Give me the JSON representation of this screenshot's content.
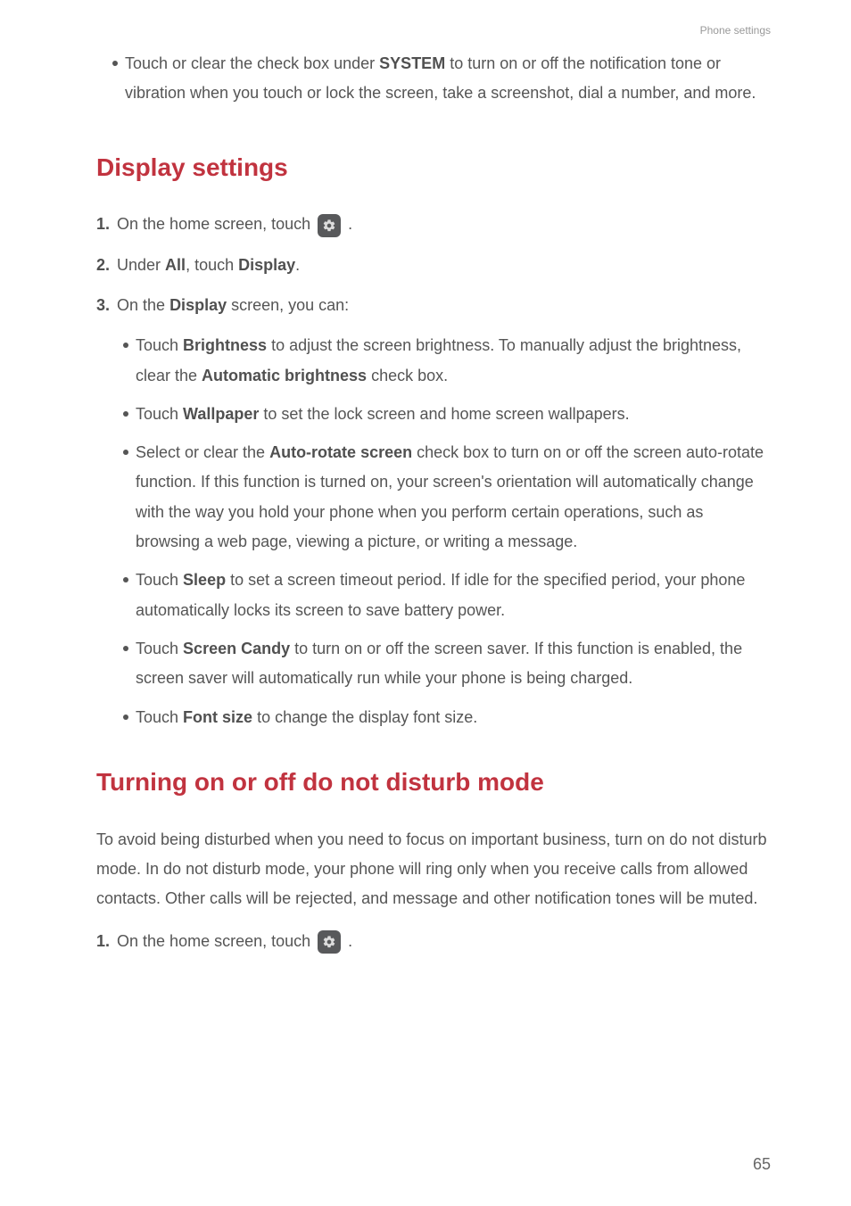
{
  "header": {
    "section": "Phone settings"
  },
  "top_bullet": {
    "t1": "Touch or clear the check box under ",
    "b1": "SYSTEM",
    "t2": " to turn on or off the notification tone or vibration when you touch or lock the screen, take a screenshot, dial a number, and more."
  },
  "section1": {
    "heading": "Display settings",
    "steps": {
      "s1": {
        "num": "1.",
        "t1": "On the home screen, touch ",
        "t2": " ."
      },
      "s2": {
        "num": "2.",
        "t1": "Under ",
        "b1": "All",
        "t2": ", touch ",
        "b2": "Display",
        "t3": "."
      },
      "s3": {
        "num": "3.",
        "t1": "On the ",
        "b1": "Display",
        "t2": " screen, you can:"
      }
    },
    "bullets": {
      "b1": {
        "t1": "Touch ",
        "b1": "Brightness",
        "t2": " to adjust the screen brightness. To manually adjust the brightness, clear the ",
        "b2": "Automatic brightness",
        "t3": " check box."
      },
      "b2": {
        "t1": "Touch ",
        "b1": "Wallpaper",
        "t2": " to set the lock screen and home screen wallpapers."
      },
      "b3": {
        "t1": "Select or clear the ",
        "b1": "Auto-rotate screen",
        "t2": " check box to turn on or off the screen auto-rotate function. If this function is turned on, your screen's orientation will automatically change with the way you hold your phone when you perform certain operations, such as browsing a web page, viewing a picture, or writing a message."
      },
      "b4": {
        "t1": "Touch ",
        "b1": "Sleep",
        "t2": " to set a screen timeout period. If idle for the specified period, your phone automatically locks its screen to save battery power."
      },
      "b5": {
        "t1": "Touch ",
        "b1": "Screen Candy",
        "t2": " to turn on or off the screen saver. If this function is enabled, the screen saver will automatically run while your phone is being charged."
      },
      "b6": {
        "t1": "Touch ",
        "b1": "Font size",
        "t2": " to change the display font size."
      }
    }
  },
  "section2": {
    "heading": "Turning on or off do not disturb mode",
    "para": "To avoid being disturbed when you need to focus on important business, turn on do not disturb mode. In do not disturb mode, your phone will ring only when you receive calls from allowed contacts. Other calls will be rejected, and message and other notification tones will be muted.",
    "steps": {
      "s1": {
        "num": "1.",
        "t1": "On the home screen, touch ",
        "t2": " ."
      }
    }
  },
  "page_number": "65"
}
